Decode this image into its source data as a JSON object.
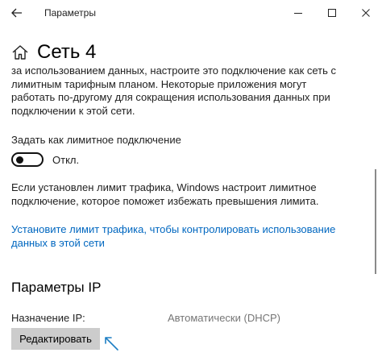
{
  "window": {
    "title": "Параметры",
    "back_icon": "back-arrow-icon",
    "controls": [
      "minimize-icon",
      "maximize-icon",
      "close-icon"
    ]
  },
  "page": {
    "title": "Сеть 4",
    "icon": "home-icon"
  },
  "metered": {
    "description": "за использованием данных, настроите это подключение как сеть с лимитным тарифным планом. Некоторые приложения могут работать по-другому для сокращения использования данных при подключении к этой сети.",
    "description_lines": [
      "за использованием данных, настроите это подключение как сеть с",
      "лимитным тарифным планом. Некоторые приложения могут",
      "работать по-другому для сокращения использования данных при",
      "подключении к этой сети."
    ],
    "toggle_label": "Задать как лимитное подключение",
    "toggle_state": "Откл.",
    "toggle_on": false,
    "limit_note_lines": [
      "Если установлен лимит трафика, Windows настроит лимитное",
      "подключение, которое поможет избежать превышения лимита."
    ],
    "link_lines": [
      "Установите лимит трафика, чтобы контролировать использование",
      "данных в этой сети"
    ]
  },
  "ip": {
    "section_title": "Параметры IP",
    "assignment_label": "Назначение IP:",
    "assignment_value": "Автоматически (DHCP)",
    "edit_button": "Редактировать"
  },
  "colors": {
    "link": "#0067c0",
    "button_bg": "#cccccc",
    "muted_text": "#767676",
    "cursor": "#1e7fc4"
  }
}
